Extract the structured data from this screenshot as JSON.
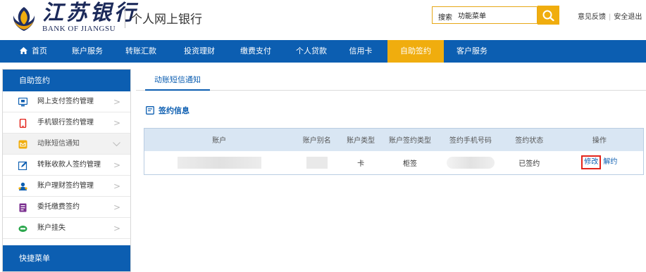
{
  "header": {
    "logo_cn": "江苏银行",
    "logo_en": "BANK OF JIANGSU",
    "subtitle": "个人网上银行",
    "search_label": "搜索",
    "search_value": "功能菜单",
    "links": [
      "意见反馈",
      "安全退出"
    ]
  },
  "nav": {
    "items": [
      "首页",
      "账户服务",
      "转账汇款",
      "投资理财",
      "缴费支付",
      "个人贷款",
      "信用卡",
      "自助签约",
      "客户服务"
    ],
    "active": "自助签约"
  },
  "sidebar": {
    "title": "自助签约",
    "items": [
      {
        "label": "网上支付签约管理",
        "icon": "monitor-icon"
      },
      {
        "label": "手机银行签约管理",
        "icon": "phone-icon"
      },
      {
        "label": "动账短信通知",
        "icon": "message-icon",
        "active": true
      },
      {
        "label": "转账收款人签约管理",
        "icon": "edit-icon"
      },
      {
        "label": "账户理财签约管理",
        "icon": "users-icon"
      },
      {
        "label": "委托缴费签约",
        "icon": "document-icon"
      },
      {
        "label": "账户挂失",
        "icon": "card-icon"
      }
    ],
    "footer": "快捷菜单"
  },
  "main": {
    "tab": "动账短信通知",
    "section_title": "签约信息",
    "table": {
      "headers": [
        "账户",
        "账户别名",
        "账户类型",
        "账户签约类型",
        "签约手机号码",
        "签约状态",
        "操作"
      ],
      "rows": [
        {
          "account": "",
          "alias": "",
          "type": "卡",
          "sign_type": "柜签",
          "phone": "",
          "status": "已签约",
          "op_edit": "修改",
          "op_cancel": "解约"
        }
      ]
    }
  },
  "colors": {
    "primary": "#0c5eb1",
    "accent": "#f0ad0e",
    "highlight": "#e3241b"
  }
}
